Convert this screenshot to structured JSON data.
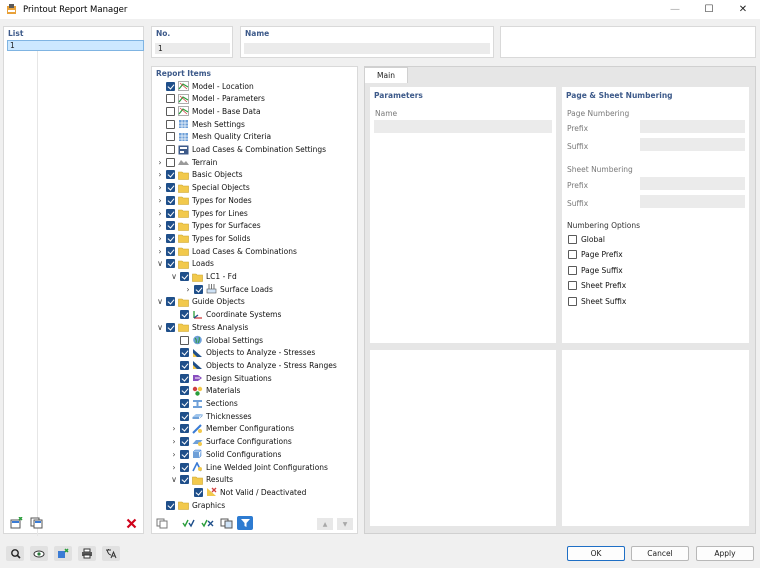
{
  "window": {
    "title": "Printout Report Manager"
  },
  "list": {
    "label": "List",
    "selected": "1"
  },
  "no": {
    "label": "No.",
    "value": "1"
  },
  "name": {
    "label": "Name",
    "value": ""
  },
  "report_items": {
    "label": "Report Items",
    "items": [
      {
        "label": "Model - Location",
        "checked": true,
        "level": 0,
        "expander": "",
        "icon": "model-icon"
      },
      {
        "label": "Model - Parameters",
        "checked": false,
        "level": 0,
        "expander": "",
        "icon": "model-icon"
      },
      {
        "label": "Model - Base Data",
        "checked": false,
        "level": 0,
        "expander": "",
        "icon": "model-icon"
      },
      {
        "label": "Mesh Settings",
        "checked": false,
        "level": 0,
        "expander": "",
        "icon": "mesh-icon"
      },
      {
        "label": "Mesh Quality Criteria",
        "checked": false,
        "level": 0,
        "expander": "",
        "icon": "mesh-icon"
      },
      {
        "label": "Load Cases & Combination Settings",
        "checked": false,
        "level": 0,
        "expander": "",
        "icon": "load-settings-icon"
      },
      {
        "label": "Terrain",
        "checked": false,
        "level": 0,
        "expander": ">",
        "icon": "terrain-icon"
      },
      {
        "label": "Basic Objects",
        "checked": true,
        "level": 0,
        "expander": ">",
        "icon": "folder-icon"
      },
      {
        "label": "Special Objects",
        "checked": true,
        "level": 0,
        "expander": ">",
        "icon": "folder-icon"
      },
      {
        "label": "Types for Nodes",
        "checked": true,
        "level": 0,
        "expander": ">",
        "icon": "folder-icon"
      },
      {
        "label": "Types for Lines",
        "checked": true,
        "level": 0,
        "expander": ">",
        "icon": "folder-icon"
      },
      {
        "label": "Types for Surfaces",
        "checked": true,
        "level": 0,
        "expander": ">",
        "icon": "folder-icon"
      },
      {
        "label": "Types for Solids",
        "checked": true,
        "level": 0,
        "expander": ">",
        "icon": "folder-icon"
      },
      {
        "label": "Load Cases & Combinations",
        "checked": true,
        "level": 0,
        "expander": ">",
        "icon": "folder-icon"
      },
      {
        "label": "Loads",
        "checked": true,
        "level": 0,
        "expander": "v",
        "icon": "folder-icon"
      },
      {
        "label": "LC1 - Fd",
        "checked": true,
        "level": 1,
        "expander": "v",
        "icon": "folder-icon"
      },
      {
        "label": "Surface Loads",
        "checked": true,
        "level": 2,
        "expander": ">",
        "icon": "surface-load-icon"
      },
      {
        "label": "Guide Objects",
        "checked": true,
        "level": 0,
        "expander": "v",
        "icon": "folder-icon"
      },
      {
        "label": "Coordinate Systems",
        "checked": true,
        "level": 1,
        "expander": "",
        "icon": "coordinate-icon"
      },
      {
        "label": "Stress Analysis",
        "checked": true,
        "level": 0,
        "expander": "v",
        "icon": "folder-icon"
      },
      {
        "label": "Global Settings",
        "checked": false,
        "level": 1,
        "expander": "",
        "icon": "globe-icon"
      },
      {
        "label": "Objects to Analyze - Stresses",
        "checked": true,
        "level": 1,
        "expander": "",
        "icon": "stress-icon"
      },
      {
        "label": "Objects to Analyze - Stress Ranges",
        "checked": true,
        "level": 1,
        "expander": "",
        "icon": "stress-icon"
      },
      {
        "label": "Design Situations",
        "checked": true,
        "level": 1,
        "expander": "",
        "icon": "design-icon"
      },
      {
        "label": "Materials",
        "checked": true,
        "level": 1,
        "expander": "",
        "icon": "materials-icon"
      },
      {
        "label": "Sections",
        "checked": true,
        "level": 1,
        "expander": "",
        "icon": "sections-icon"
      },
      {
        "label": "Thicknesses",
        "checked": true,
        "level": 1,
        "expander": "",
        "icon": "thickness-icon"
      },
      {
        "label": "Member Configurations",
        "checked": true,
        "level": 1,
        "expander": ">",
        "icon": "member-config-icon"
      },
      {
        "label": "Surface Configurations",
        "checked": true,
        "level": 1,
        "expander": ">",
        "icon": "surface-config-icon"
      },
      {
        "label": "Solid Configurations",
        "checked": true,
        "level": 1,
        "expander": ">",
        "icon": "solid-config-icon"
      },
      {
        "label": "Line Welded Joint Configurations",
        "checked": true,
        "level": 1,
        "expander": ">",
        "icon": "weld-config-icon"
      },
      {
        "label": "Results",
        "checked": true,
        "level": 1,
        "expander": "v",
        "icon": "folder-icon"
      },
      {
        "label": "Not Valid / Deactivated",
        "checked": true,
        "level": 2,
        "expander": "",
        "icon": "not-valid-icon"
      },
      {
        "label": "Graphics",
        "checked": true,
        "level": 0,
        "expander": "",
        "icon": "folder-icon"
      }
    ]
  },
  "main": {
    "tab": "Main",
    "parameters": {
      "title": "Parameters",
      "name_label": "Name"
    },
    "numbering": {
      "title": "Page & Sheet Numbering",
      "page_numbering": "Page Numbering",
      "sheet_numbering": "Sheet Numbering",
      "prefix": "Prefix",
      "suffix": "Suffix",
      "options_title": "Numbering Options",
      "options": [
        "Global",
        "Page Prefix",
        "Page Suffix",
        "Sheet Prefix",
        "Sheet Suffix"
      ]
    }
  },
  "buttons": {
    "ok": "OK",
    "cancel": "Cancel",
    "apply": "Apply"
  },
  "colors": {
    "accent": "#1f4f8a",
    "label_blue": "#3d5a8a",
    "folder": "#f2c94c",
    "delete": "#d0021b",
    "active_tool": "#2d7bd1"
  }
}
